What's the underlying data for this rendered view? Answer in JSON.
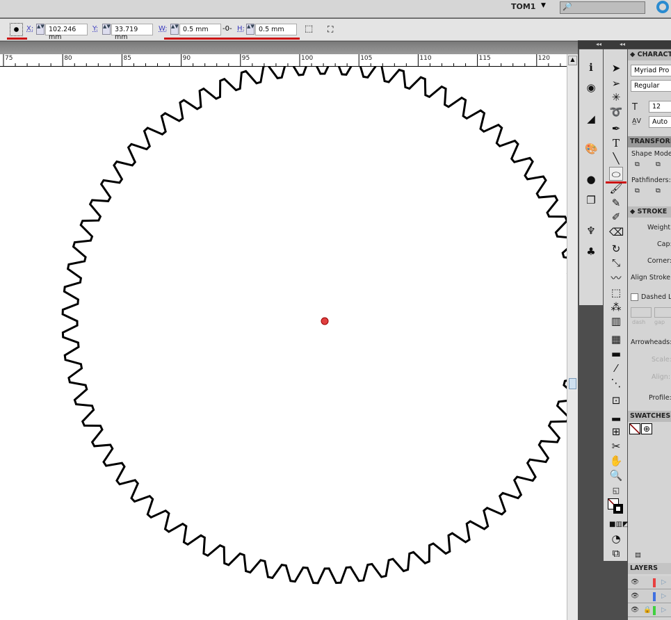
{
  "appbar": {
    "workspace": "TOM1",
    "workspace_arrow": "▼",
    "search_icon": "🔎"
  },
  "control": {
    "x_label": "X:",
    "x_value": "102.246 mm",
    "y_label": "Y:",
    "y_value": "33.719 mm",
    "w_label": "W:",
    "w_value": "0.5 mm",
    "h_label": "H:",
    "h_value": "0.5 mm",
    "link_icon": "-0-",
    "spin": "▲▼"
  },
  "ruler": {
    "ticks": [
      "75",
      "80",
      "85",
      "90",
      "95",
      "100",
      "105",
      "110",
      "115",
      "120"
    ]
  },
  "gear": {
    "teeth": 72
  },
  "dock": {
    "collapse": "◂◂"
  },
  "panels": {
    "character": {
      "title": "◆ CHARACTER",
      "font": "Myriad Pro",
      "style": "Regular",
      "size": "12",
      "tracking": "Auto"
    },
    "transform": {
      "title": "TRANSFORM",
      "shape_modes": "Shape Modes:",
      "pathfinders": "Pathfinders:"
    },
    "stroke": {
      "title": "◆ STROKE",
      "weight": "Weight:",
      "cap": "Cap:",
      "corner": "Corner:",
      "align": "Align Stroke:",
      "dashed": "Dashed Line",
      "dash": "dash",
      "gap": "gap",
      "arrowheads": "Arrowheads:",
      "scale": "Scale:",
      "align2": "Align:",
      "profile": "Profile:"
    },
    "swatches": {
      "title": "SWATCHES"
    },
    "layers": {
      "title": "LAYERS",
      "colors": [
        "#e84040",
        "#4070e0",
        "#40d040"
      ]
    }
  }
}
